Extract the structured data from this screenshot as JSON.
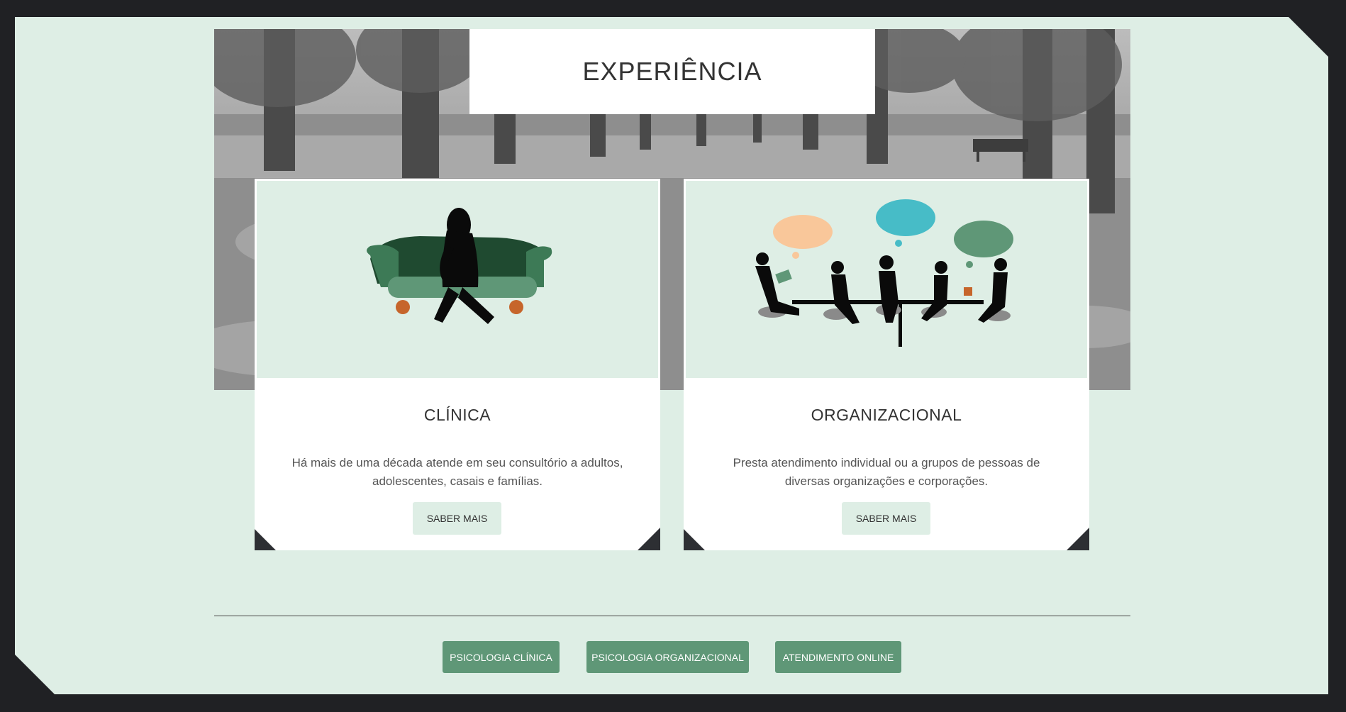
{
  "section": {
    "title": "EXPERIÊNCIA"
  },
  "cards": [
    {
      "title": "CLÍNICA",
      "description": "Há mais de uma década atende em seu consultório a adultos, adolescentes, casais e famílias.",
      "button": "SABER MAIS",
      "illustration": "sofa-woman-illustration"
    },
    {
      "title": "ORGANIZACIONAL",
      "description": "Presta atendimento individual ou a grupos de pessoas de diversas organizações e corporações.",
      "button": "SABER MAIS",
      "illustration": "meeting-group-illustration"
    }
  ],
  "footer": {
    "buttons": [
      "PSICOLOGIA CLÍNICA",
      "PSICOLOGIA ORGANIZACIONAL",
      "ATENDIMENTO ONLINE"
    ]
  },
  "colors": {
    "page_background": "#deeee5",
    "frame": "#202124",
    "accent_green": "#5f9777",
    "dark_green": "#1f4a30",
    "sofa_orange": "#c6652b"
  }
}
